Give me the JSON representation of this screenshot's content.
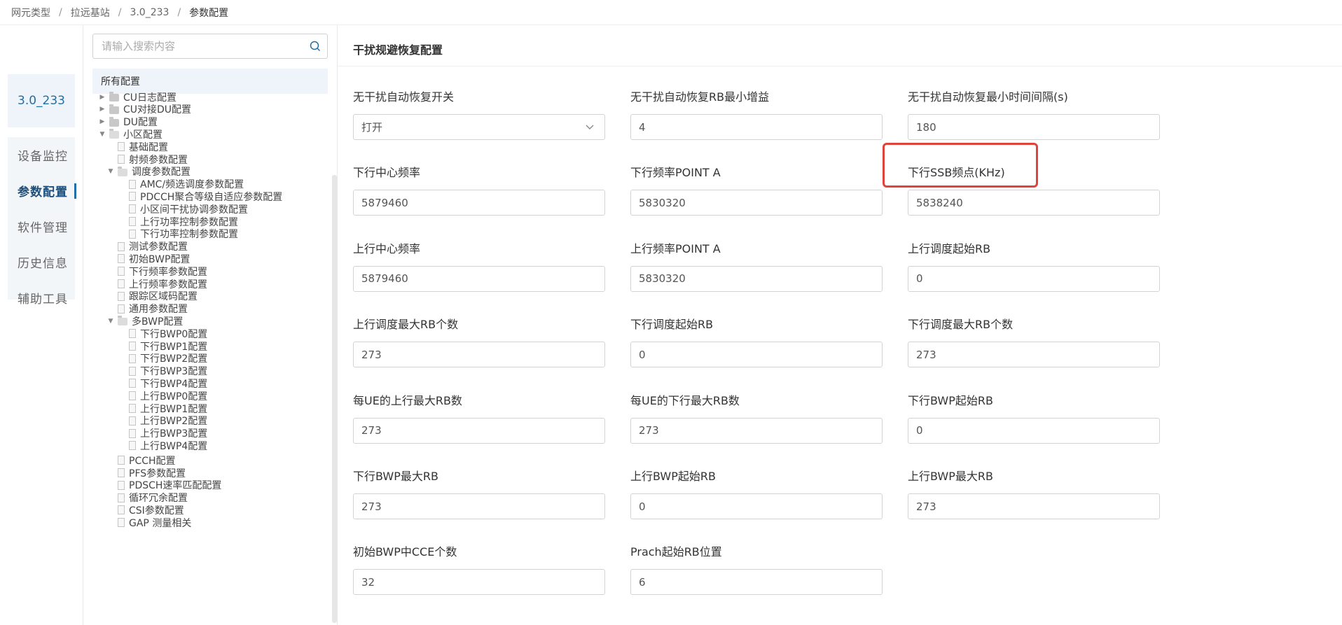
{
  "breadcrumb": [
    "网元类型",
    "拉远基站",
    "3.0_233",
    "参数配置"
  ],
  "left_nav": {
    "ne_name": "3.0_233",
    "items": [
      {
        "label": "设备监控",
        "active": false
      },
      {
        "label": "参数配置",
        "active": true
      },
      {
        "label": "软件管理",
        "active": false
      },
      {
        "label": "历史信息",
        "active": false
      },
      {
        "label": "辅助工具",
        "active": false
      }
    ]
  },
  "tree": {
    "search_placeholder": "请输入搜索内容",
    "root": "所有配置",
    "nodes": [
      {
        "label": "CU日志配置",
        "type": "folder",
        "level": 0,
        "expanded": false
      },
      {
        "label": "CU对接DU配置",
        "type": "folder",
        "level": 0,
        "expanded": false
      },
      {
        "label": "DU配置",
        "type": "folder",
        "level": 0,
        "expanded": false
      },
      {
        "label": "小区配置",
        "type": "folder",
        "level": 0,
        "expanded": true
      },
      {
        "label": "基础配置",
        "type": "file",
        "level": 1
      },
      {
        "label": "射频参数配置",
        "type": "file",
        "level": 1
      },
      {
        "label": "调度参数配置",
        "type": "folder",
        "level": 1,
        "expanded": true
      },
      {
        "label": "AMC/频选调度参数配置",
        "type": "file",
        "level": 2
      },
      {
        "label": "PDCCH聚合等级自适应参数配置",
        "type": "file",
        "level": 2
      },
      {
        "label": "小区间干扰协调参数配置",
        "type": "file",
        "level": 2
      },
      {
        "label": "上行功率控制参数配置",
        "type": "file",
        "level": 2
      },
      {
        "label": "下行功率控制参数配置",
        "type": "file",
        "level": 2
      },
      {
        "label": "测试参数配置",
        "type": "file",
        "level": 1
      },
      {
        "label": "初始BWP配置",
        "type": "file",
        "level": 1
      },
      {
        "label": "下行频率参数配置",
        "type": "file",
        "level": 1
      },
      {
        "label": "上行频率参数配置",
        "type": "file",
        "level": 1
      },
      {
        "label": "跟踪区域码配置",
        "type": "file",
        "level": 1
      },
      {
        "label": "通用参数配置",
        "type": "file",
        "level": 1
      },
      {
        "label": "多BWP配置",
        "type": "folder",
        "level": 1,
        "expanded": true
      },
      {
        "label": "下行BWP0配置",
        "type": "file",
        "level": 2
      },
      {
        "label": "下行BWP1配置",
        "type": "file",
        "level": 2
      },
      {
        "label": "下行BWP2配置",
        "type": "file",
        "level": 2
      },
      {
        "label": "下行BWP3配置",
        "type": "file",
        "level": 2
      },
      {
        "label": "下行BWP4配置",
        "type": "file",
        "level": 2
      },
      {
        "label": "上行BWP0配置",
        "type": "file",
        "level": 2
      },
      {
        "label": "上行BWP1配置",
        "type": "file",
        "level": 2
      },
      {
        "label": "上行BWP2配置",
        "type": "file",
        "level": 2
      },
      {
        "label": "上行BWP3配置",
        "type": "file",
        "level": 2
      },
      {
        "label": "上行BWP4配置",
        "type": "file",
        "level": 2
      },
      {
        "label": "PCCH配置",
        "type": "file",
        "level": 1
      },
      {
        "label": "PFS参数配置",
        "type": "file",
        "level": 1
      },
      {
        "label": "PDSCH速率匹配配置",
        "type": "file",
        "level": 1
      },
      {
        "label": "循环冗余配置",
        "type": "file",
        "level": 1
      },
      {
        "label": "CSI参数配置",
        "type": "file",
        "level": 1
      },
      {
        "label": "GAP 测量相关",
        "type": "file",
        "level": 1
      }
    ]
  },
  "main": {
    "section_title": "干扰规避恢复配置",
    "fields": [
      {
        "label": "无干扰自动恢复开关",
        "value": "打开",
        "type": "select"
      },
      {
        "label": "无干扰自动恢复RB最小增益",
        "value": "4",
        "type": "input"
      },
      {
        "label": "无干扰自动恢复最小时间间隔(s)",
        "value": "180",
        "type": "input"
      },
      {
        "label": "下行中心频率",
        "value": "5879460",
        "type": "input"
      },
      {
        "label": "下行频率POINT A",
        "value": "5830320",
        "type": "input"
      },
      {
        "label": "下行SSB频点(KHz)",
        "value": "5838240",
        "type": "input",
        "highlighted": true
      },
      {
        "label": "上行中心频率",
        "value": "5879460",
        "type": "input"
      },
      {
        "label": "上行频率POINT A",
        "value": "5830320",
        "type": "input"
      },
      {
        "label": "上行调度起始RB",
        "value": "0",
        "type": "input"
      },
      {
        "label": "上行调度最大RB个数",
        "value": "273",
        "type": "input"
      },
      {
        "label": "下行调度起始RB",
        "value": "0",
        "type": "input"
      },
      {
        "label": "下行调度最大RB个数",
        "value": "273",
        "type": "input"
      },
      {
        "label": "每UE的上行最大RB数",
        "value": "273",
        "type": "input"
      },
      {
        "label": "每UE的下行最大RB数",
        "value": "273",
        "type": "input"
      },
      {
        "label": "下行BWP起始RB",
        "value": "0",
        "type": "input"
      },
      {
        "label": "下行BWP最大RB",
        "value": "273",
        "type": "input"
      },
      {
        "label": "上行BWP起始RB",
        "value": "0",
        "type": "input"
      },
      {
        "label": "上行BWP最大RB",
        "value": "273",
        "type": "input"
      },
      {
        "label": "初始BWP中CCE个数",
        "value": "32",
        "type": "input"
      },
      {
        "label": "Prach起始RB位置",
        "value": "6",
        "type": "input"
      }
    ]
  },
  "colors": {
    "accent": "#1f6fa8",
    "highlight": "#e0433b",
    "nav_bg": "#f2f6f9"
  }
}
